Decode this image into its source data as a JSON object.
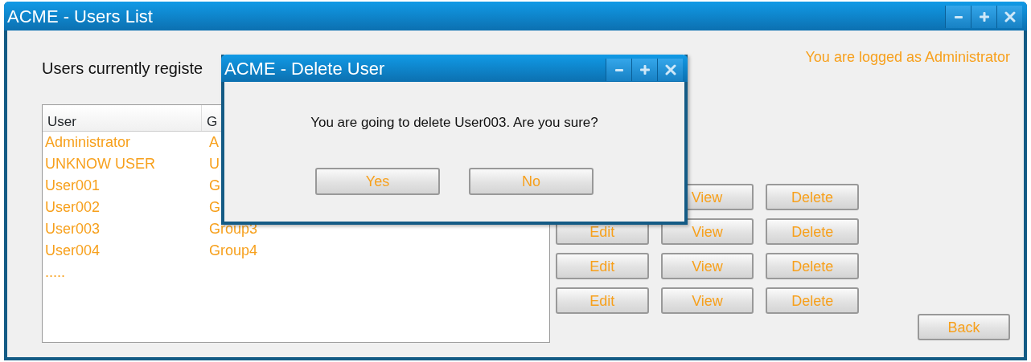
{
  "window": {
    "title": "ACME - Users List"
  },
  "heading": "Users currently registe",
  "login_status": "You are logged as Administrator",
  "users_table": {
    "columns": [
      "User",
      "G"
    ],
    "rows": [
      {
        "user": "Administrator",
        "group": "A"
      },
      {
        "user": "UNKNOW USER",
        "group": "U"
      },
      {
        "user": "User001",
        "group": "G"
      },
      {
        "user": "User002",
        "group": "G"
      },
      {
        "user": "User003",
        "group": "Group3"
      },
      {
        "user": "User004",
        "group": "Group4"
      },
      {
        "user": ".....",
        "group": ""
      }
    ]
  },
  "row_actions": [
    {
      "buttons": [
        "View",
        "Delete"
      ]
    },
    {
      "buttons": [
        "Edit",
        "View",
        "Delete"
      ]
    },
    {
      "buttons": [
        "Edit",
        "View",
        "Delete"
      ]
    },
    {
      "buttons": [
        "Edit",
        "View",
        "Delete"
      ]
    }
  ],
  "back_button": "Back",
  "dialog": {
    "title": "ACME - Delete User",
    "message": "You are going to delete User003. Are you sure?",
    "buttons": [
      "Yes",
      "No"
    ]
  }
}
